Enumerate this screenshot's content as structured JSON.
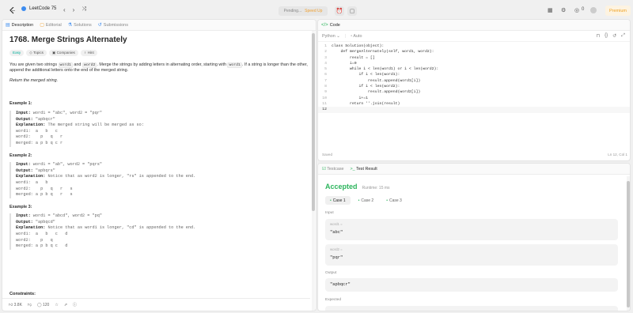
{
  "topbar": {
    "list_name": "LeetCode 75",
    "run_status": "Pending...",
    "run_speed": "Speed Up",
    "premium": "Premium",
    "points": "0"
  },
  "left_tabs": [
    "Description",
    "Editorial",
    "Solutions",
    "Submissions"
  ],
  "problem": {
    "title": "1768. Merge Strings Alternately",
    "tags": [
      "Easy",
      "Topics",
      "Companies",
      "Hint"
    ],
    "desc_part1": "You are given two strings ",
    "desc_code1": "word1",
    "desc_part2": " and ",
    "desc_code2": "word2",
    "desc_part3": ". Merge the strings by adding letters in alternating order, starting with ",
    "desc_code3": "word1",
    "desc_part4": ". If a string is longer than the other, append the additional letters onto the end of the merged string.",
    "return_text": "Return the merged string.",
    "examples": [
      {
        "head": "Example 1:",
        "input_label": "Input:",
        "input": " word1 = \"abc\", word2 = \"pqr\"",
        "output_label": "Output:",
        "output": " \"apbqcr\"",
        "expl_label": "Explanation:",
        "expl": " The merged string will be merged as so:",
        "lines": [
          "word1:  a   b   c",
          "word2:    p   q   r",
          "merged: a p b q c r"
        ]
      },
      {
        "head": "Example 2:",
        "input_label": "Input:",
        "input": " word1 = \"ab\", word2 = \"pqrs\"",
        "output_label": "Output:",
        "output": " \"apbqrs\"",
        "expl_label": "Explanation:",
        "expl": " Notice that as word2 is longer, \"rs\" is appended to the end.",
        "lines": [
          "word1:  a   b",
          "word2:    p   q   r   s",
          "merged: a p b q   r   s"
        ]
      },
      {
        "head": "Example 3:",
        "input_label": "Input:",
        "input": " word1 = \"abcd\", word2 = \"pq\"",
        "output_label": "Output:",
        "output": " \"apbqcd\"",
        "expl_label": "Explanation:",
        "expl": " Notice that as word1 is longer, \"cd\" is appended to the end.",
        "lines": [
          "word1:  a   b   c   d",
          "word2:    p   q",
          "merged: a p b q c   d"
        ]
      }
    ],
    "constraints": "Constraints:"
  },
  "left_footer": {
    "likes": "3.8K",
    "comments": "120"
  },
  "code_panel": {
    "tab": "Code",
    "language": "Python",
    "mode": "Auto",
    "saved": "Saved",
    "cursor": "Ln 12, Col 1",
    "lines": [
      "class Solution(object):",
      "    def mergeAlternately(self, word1, word2):",
      "        result = []",
      "        i=0",
      "        while i < len(word1) or i < len(word2):",
      "            if i < len(word1):",
      "                result.append(word1[i])",
      "            if i < len(word2):",
      "                result.append(word2[i])",
      "            i+=1",
      "        return ''.join(result)",
      ""
    ]
  },
  "result_panel": {
    "tabs": [
      "Testcase",
      "Test Result"
    ],
    "status": "Accepted",
    "runtime": "Runtime: 15 ms",
    "cases": [
      "Case 1",
      "Case 2",
      "Case 3"
    ],
    "input_label": "Input",
    "var1_name": "word1 =",
    "var1_value": "\"abc\"",
    "var2_name": "word2 =",
    "var2_value": "\"pqr\"",
    "output_label": "Output",
    "output_value": "\"apbqcr\"",
    "expected_label": "Expected"
  },
  "colors": {
    "accent_green": "#2db55d",
    "easy": "#00af9b",
    "premium": "#f0a020"
  }
}
